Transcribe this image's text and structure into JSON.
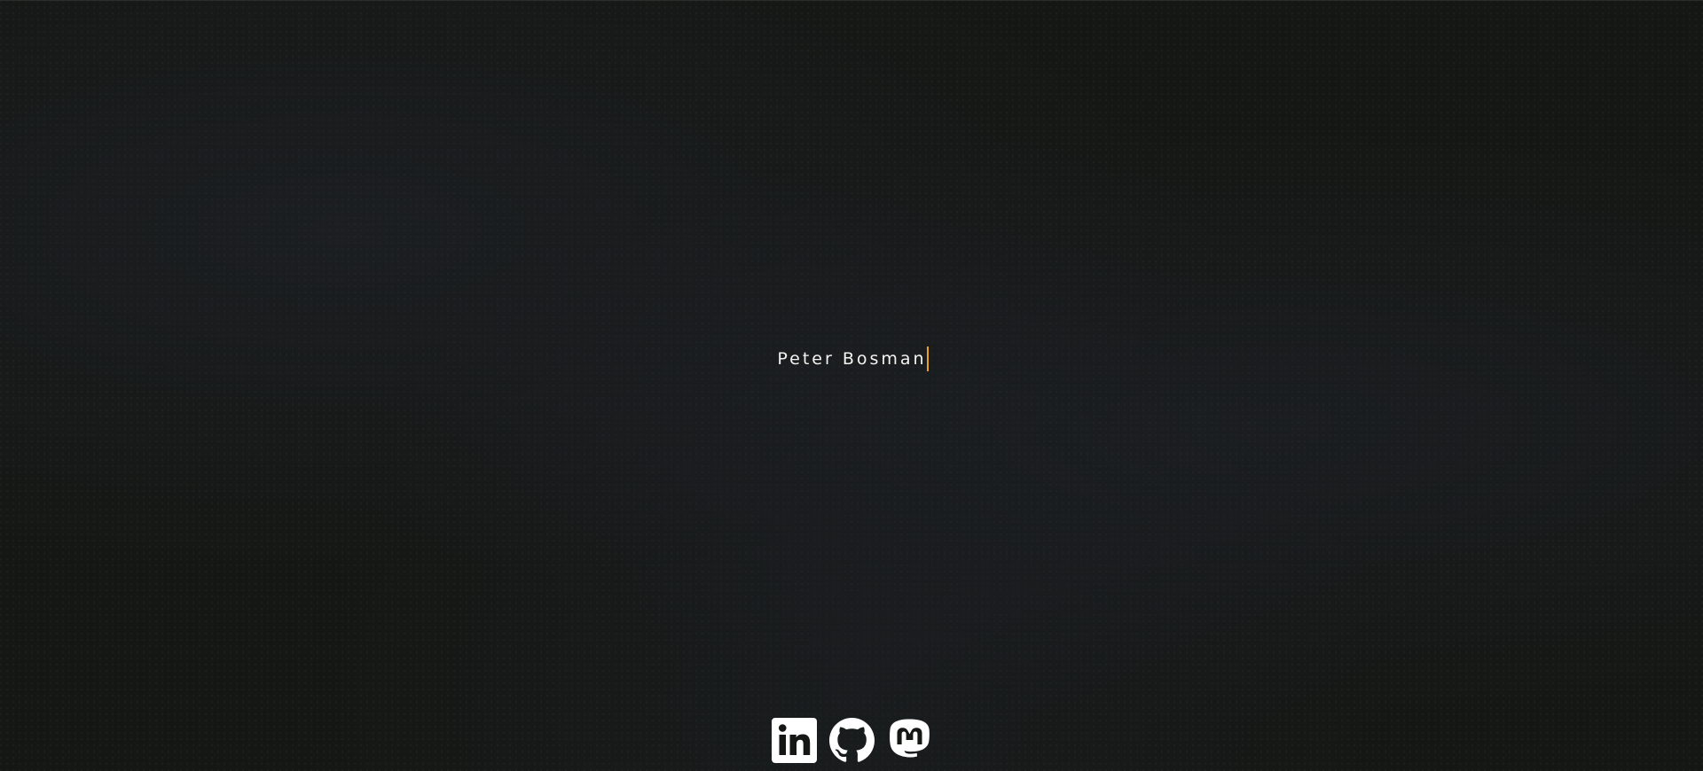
{
  "hero": {
    "name": "Peter Bosman"
  },
  "colors": {
    "background": "#151714",
    "text": "#f3f3f0",
    "cursor_accent": "#e8a21d",
    "icon": "#ffffff"
  },
  "socials": [
    {
      "icon": "linkedin-icon"
    },
    {
      "icon": "github-icon"
    },
    {
      "icon": "mastodon-icon"
    }
  ]
}
